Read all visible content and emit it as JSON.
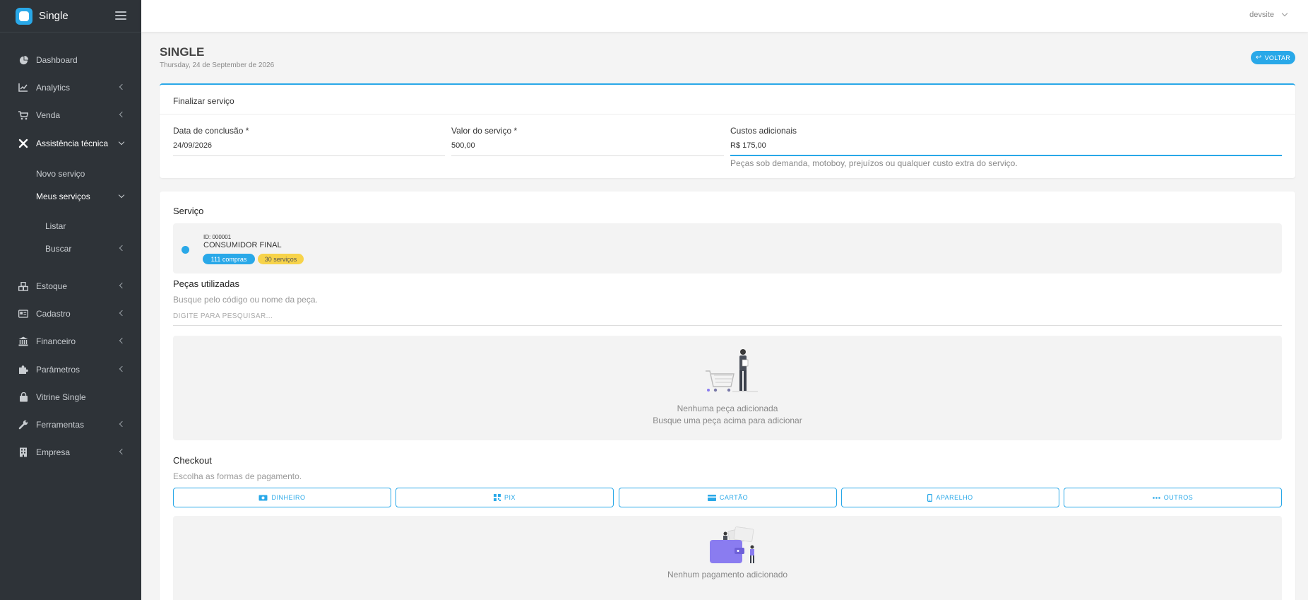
{
  "app": {
    "name": "Single"
  },
  "user": {
    "name": "devsite"
  },
  "sidebar": {
    "items": [
      {
        "label": "Dashboard",
        "icon": "pie-chart-icon"
      },
      {
        "label": "Analytics",
        "icon": "line-chart-icon"
      },
      {
        "label": "Venda",
        "icon": "cart-icon"
      },
      {
        "label": "Assistência técnica",
        "icon": "tools-icon"
      },
      {
        "label": "Estoque",
        "icon": "cubes-icon"
      },
      {
        "label": "Cadastro",
        "icon": "id-card-icon"
      },
      {
        "label": "Financeiro",
        "icon": "bank-icon"
      },
      {
        "label": "Parâmetros",
        "icon": "puzzle-icon"
      },
      {
        "label": "Vitrine Single",
        "icon": "bag-icon"
      },
      {
        "label": "Ferramentas",
        "icon": "wrench-icon"
      },
      {
        "label": "Empresa",
        "icon": "building-icon"
      }
    ],
    "submenu": {
      "novo_servico": "Novo serviço",
      "meus_servicos": "Meus serviços",
      "listar": "Listar",
      "buscar": "Buscar"
    }
  },
  "header": {
    "title": "SINGLE",
    "date": "Thursday, 24 de September de 2026",
    "back_label": "VOLTAR"
  },
  "finalizar": {
    "title": "Finalizar serviço",
    "data_label": "Data de conclusão *",
    "data_value": "24/09/2026",
    "valor_label": "Valor do serviço *",
    "valor_value": "500,00",
    "custos_label": "Custos adicionais",
    "custos_value": "R$ 175,00",
    "custos_help": "Peças sob demanda, motoboy, prejuízos ou qualquer custo extra do serviço."
  },
  "servico": {
    "title": "Serviço",
    "client_id": "ID: 000001",
    "client_name": "CONSUMIDOR FINAL",
    "badge_compras": "111 compras",
    "badge_servicos": "30 serviços"
  },
  "pecas": {
    "title": "Peças utilizadas",
    "subtitle": "Busque pelo código ou nome da peça.",
    "search_placeholder": "DIGITE PARA PESQUISAR...",
    "empty_line1": "Nenhuma peça adicionada",
    "empty_line2": "Busque uma peça acima para adicionar"
  },
  "checkout": {
    "title": "Checkout",
    "subtitle": "Escolha as formas de pagamento.",
    "buttons": [
      "DINHEIRO",
      "PIX",
      "CARTÃO",
      "APARELHO",
      "OUTROS"
    ],
    "empty": "Nenhum pagamento adicionado"
  },
  "colors": {
    "accent": "#29a8e8",
    "sidebar": "#2e3338",
    "badge_yellow": "#f7d34a"
  }
}
